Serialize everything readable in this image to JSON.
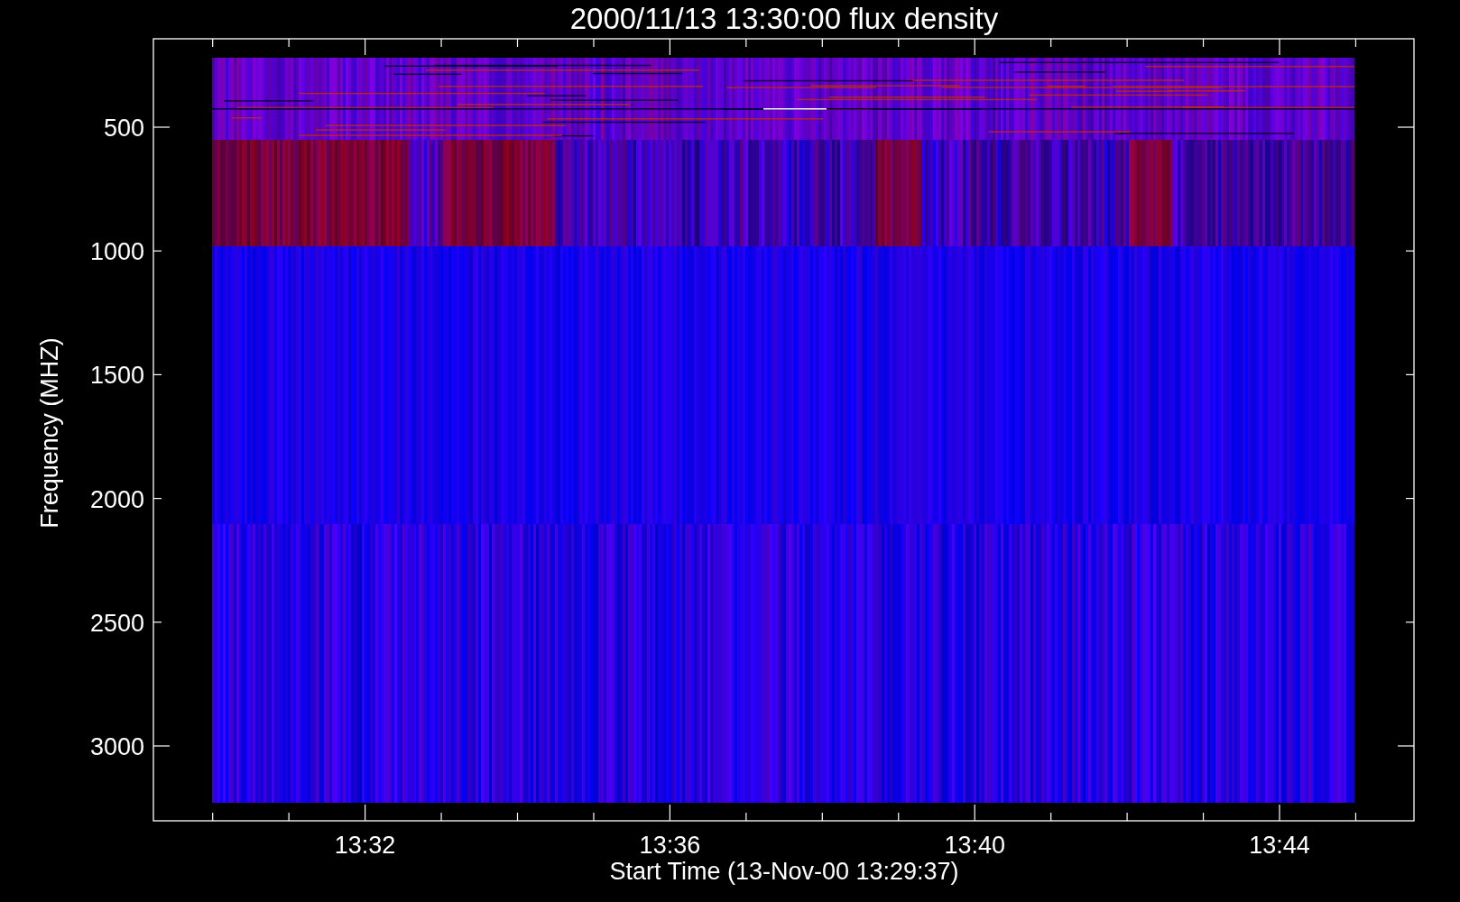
{
  "title": "2000/11/13 13:30:00 flux density",
  "plot": {
    "ylabel": "Frequency (MHZ)",
    "xlabel": "Start Time (13-Nov-00 13:29:37)",
    "yticks": [
      "500",
      "1000",
      "1500",
      "2000",
      "2500",
      "3000"
    ],
    "xticks": [
      "13:32",
      "13:36",
      "13:40",
      "13:44"
    ]
  }
}
